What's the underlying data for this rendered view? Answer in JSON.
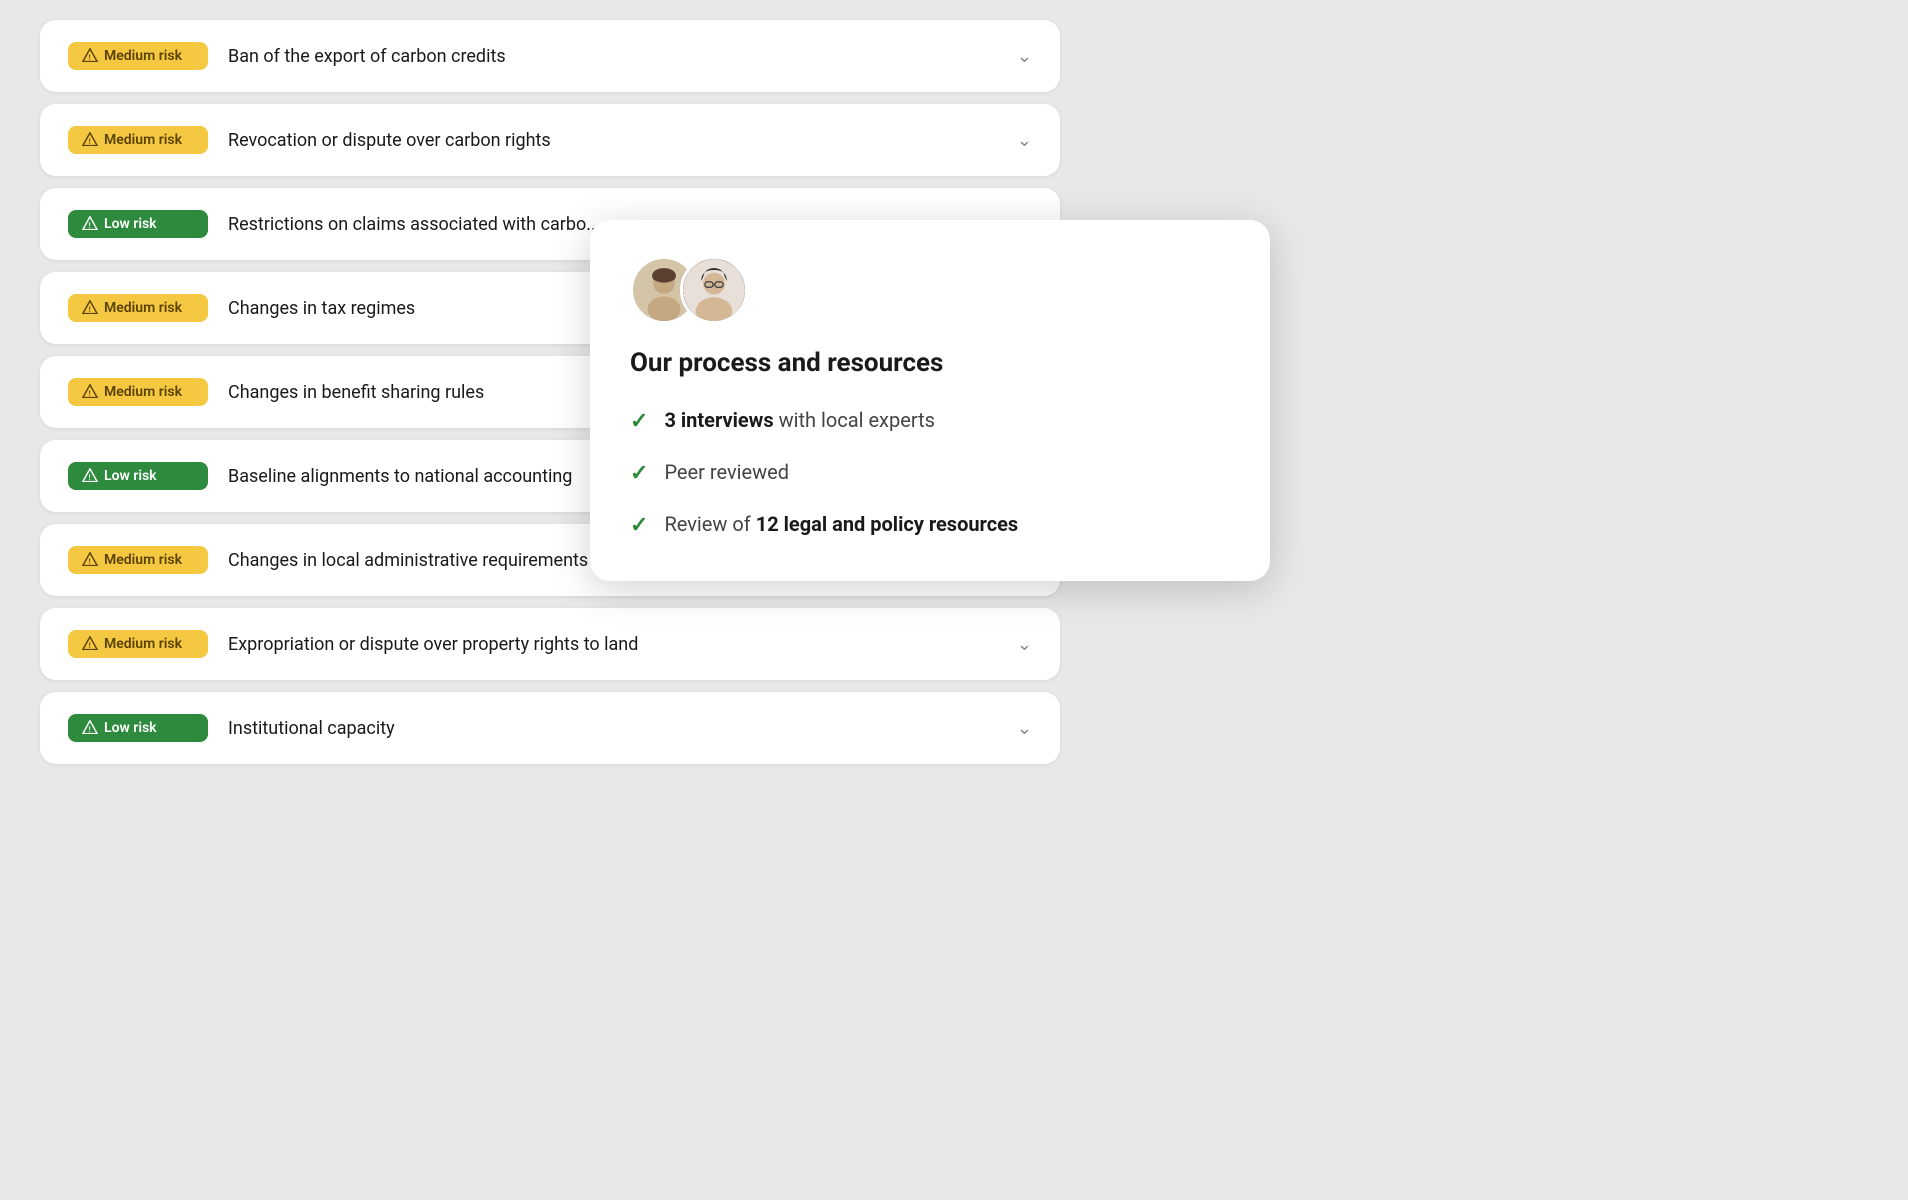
{
  "riskItems": [
    {
      "id": 1,
      "level": "medium",
      "badgeLabel": "Medium risk",
      "title": "Ban of the export of carbon credits",
      "hasChevron": true
    },
    {
      "id": 2,
      "level": "medium",
      "badgeLabel": "Medium risk",
      "title": "Revocation or dispute over carbon rights",
      "hasChevron": true
    },
    {
      "id": 3,
      "level": "low",
      "badgeLabel": "Low risk",
      "title": "Restrictions on claims associated with carbo...",
      "hasChevron": false
    },
    {
      "id": 4,
      "level": "medium",
      "badgeLabel": "Medium risk",
      "title": "Changes in tax regimes",
      "hasChevron": false
    },
    {
      "id": 5,
      "level": "medium",
      "badgeLabel": "Medium risk",
      "title": "Changes in benefit sharing rules",
      "hasChevron": false
    },
    {
      "id": 6,
      "level": "low",
      "badgeLabel": "Low risk",
      "title": "Baseline alignments to national accounting",
      "hasChevron": false
    },
    {
      "id": 7,
      "level": "medium",
      "badgeLabel": "Medium risk",
      "title": "Changes in local administrative requirements",
      "hasChevron": true
    },
    {
      "id": 8,
      "level": "medium",
      "badgeLabel": "Medium risk",
      "title": "Expropriation or dispute over property rights to land",
      "hasChevron": true
    },
    {
      "id": 9,
      "level": "low",
      "badgeLabel": "Low risk",
      "title": "Institutional capacity",
      "hasChevron": true
    }
  ],
  "popup": {
    "heading": "Our process and resources",
    "listItems": [
      {
        "id": 1,
        "bold": "3 interviews",
        "rest": " with local experts"
      },
      {
        "id": 2,
        "bold": "",
        "rest": "Peer reviewed"
      },
      {
        "id": 3,
        "bold": "12 legal and policy resources",
        "rest": "",
        "prefix": "Review of "
      }
    ]
  },
  "colors": {
    "medium": "#F5C842",
    "low": "#2E8B3E",
    "check": "#2E8B3E"
  }
}
